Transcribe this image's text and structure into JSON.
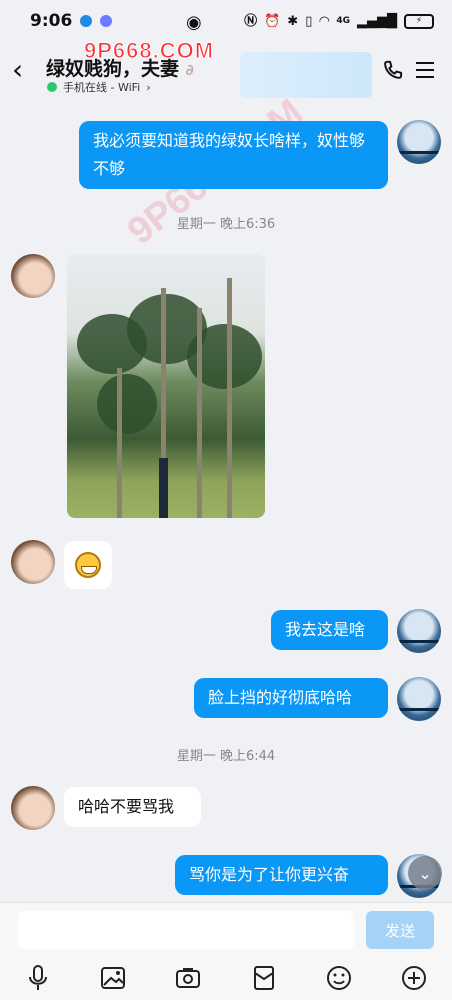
{
  "status_bar": {
    "time": "9:06",
    "signal_label": "4G",
    "battery_label": "⚡"
  },
  "header": {
    "title": "绿奴贱狗，夫妻",
    "online_status": "手机在线 - WiFi"
  },
  "watermark": {
    "top_text": "9P668.COM",
    "diagonal_text": "9P668.COM"
  },
  "messages": [
    {
      "side": "out",
      "text": "我必须要知道我的绿奴长啥样，奴性够不够"
    },
    {
      "type": "timestamp",
      "text": "星期一 晚上6:36"
    },
    {
      "side": "in",
      "type": "photo"
    },
    {
      "side": "in",
      "type": "emoji",
      "emoji": "grin-emoji"
    },
    {
      "side": "out",
      "text": "我去这是啥"
    },
    {
      "side": "out",
      "text": "脸上挡的好彻底哈哈"
    },
    {
      "type": "timestamp",
      "text": "星期一 晚上6:44"
    },
    {
      "side": "in",
      "text": "哈哈不要骂我"
    },
    {
      "side": "out",
      "text": "骂你是为了让你更兴奋"
    }
  ],
  "input": {
    "value": "",
    "placeholder": "",
    "send_label": "发送"
  },
  "toolbar_icons": [
    "microphone-icon",
    "image-icon",
    "camera-icon",
    "red-packet-icon",
    "emoji-icon",
    "plus-icon"
  ],
  "colors": {
    "outgoing_bubble": "#0a97f5",
    "incoming_bubble": "#ffffff",
    "background": "#f0f1f5",
    "online_dot": "#2fc76a",
    "watermark": "#ff2f3a",
    "send_button": "#a4d3f7"
  }
}
